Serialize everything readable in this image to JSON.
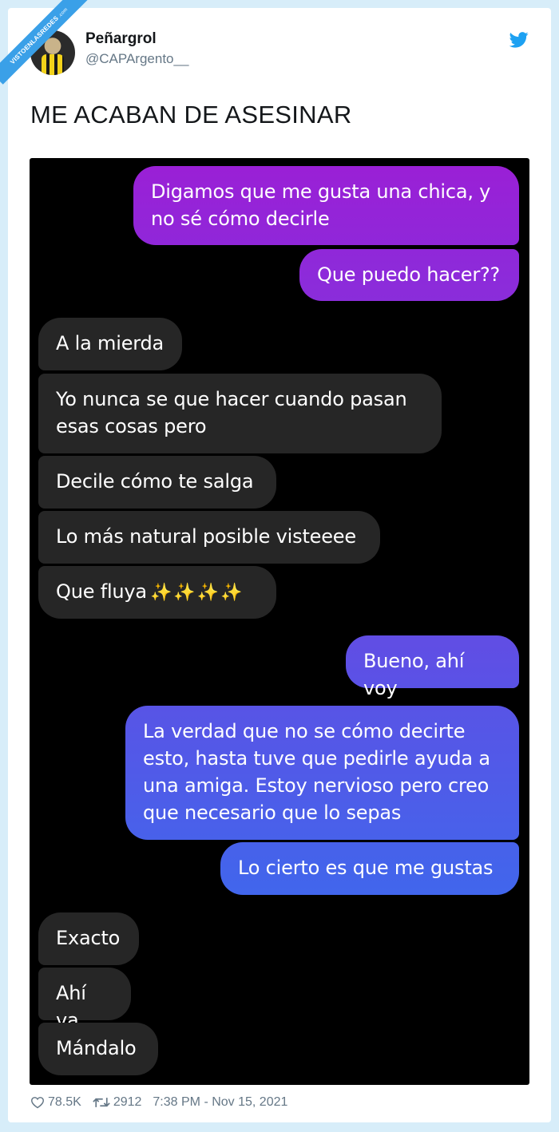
{
  "watermark": {
    "text": "VISTOENLASREDES",
    "suffix": ".com"
  },
  "tweet": {
    "author_name": "Peñargrol",
    "author_handle": "@CAPArgento__",
    "text": "ME ACABAN DE ASESINAR"
  },
  "chat": {
    "messages": [
      {
        "side": "out",
        "text": "Digamos que me gusta una chica, y\nno sé cómo decirle"
      },
      {
        "side": "out",
        "text": "Que puedo hacer??"
      },
      {
        "side": "in",
        "text": "A la mierda"
      },
      {
        "side": "in",
        "text": "Yo nunca se que hacer cuando pasan\nesas cosas pero"
      },
      {
        "side": "in",
        "text": "Decile cómo te salga"
      },
      {
        "side": "in",
        "text": "Lo más natural posible visteeee"
      },
      {
        "side": "in",
        "text": "Que fluya",
        "emoji": "✨✨✨✨"
      },
      {
        "side": "out",
        "text": "Bueno, ahí voy"
      },
      {
        "side": "out",
        "text": "La verdad que no se cómo decirte\nesto, hasta tuve que pedirle ayuda a\nuna amiga. Estoy nervioso pero creo\nque necesario que lo sepas"
      },
      {
        "side": "out",
        "text": "Lo cierto es que me gustas"
      },
      {
        "side": "in",
        "text": "Exacto"
      },
      {
        "side": "in",
        "text": "Ahí va"
      },
      {
        "side": "in",
        "text": "Mándalo"
      }
    ]
  },
  "footer": {
    "likes": "78.5K",
    "retweets": "2912",
    "timestamp": "7:38 PM - Nov 15, 2021"
  },
  "colors": {
    "twitter_blue": "#1da1f2",
    "incoming_bubble": "#262626",
    "gradient_top": "#9b1fd6",
    "gradient_bottom": "#2f74f0"
  },
  "icons": [
    "twitter-bird-icon",
    "heart-icon",
    "retweet-icon"
  ]
}
